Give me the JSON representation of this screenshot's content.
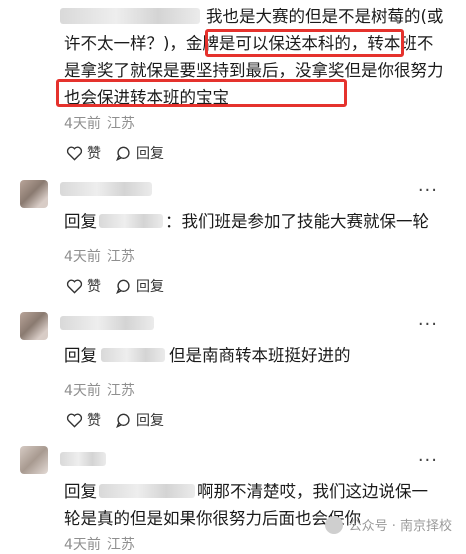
{
  "comments": [
    {
      "text": "我也是大赛的但是不是树莓的(或许不太一样？)，金牌是可以保送本科的，转本班不是拿奖了就保是要坚持到最后，没拿奖但是你很努力也会保进转本班的宝宝",
      "time": "4天前",
      "location": "江苏",
      "like_label": "赞",
      "reply_label": "回复"
    },
    {
      "reply_prefix": "回复",
      "text": "：我们班是参加了技能大赛就保一轮",
      "time": "4天前",
      "location": "江苏",
      "like_label": "赞",
      "reply_label": "回复"
    },
    {
      "reply_prefix": "回复",
      "text": "但是南商转本班挺好进的",
      "time": "4天前",
      "location": "江苏",
      "like_label": "赞",
      "reply_label": "回复"
    },
    {
      "reply_prefix": "回复",
      "text": "啊那不清楚哎，我们这边说保一轮是真的但是如果你很努力后面也会保你",
      "time": "4天前",
      "location": "江苏"
    }
  ],
  "more_label": "···",
  "watermark": "公众号 · 南京择校",
  "colors": {
    "highlight": "#e5322d",
    "meta": "#8f8f8f"
  }
}
